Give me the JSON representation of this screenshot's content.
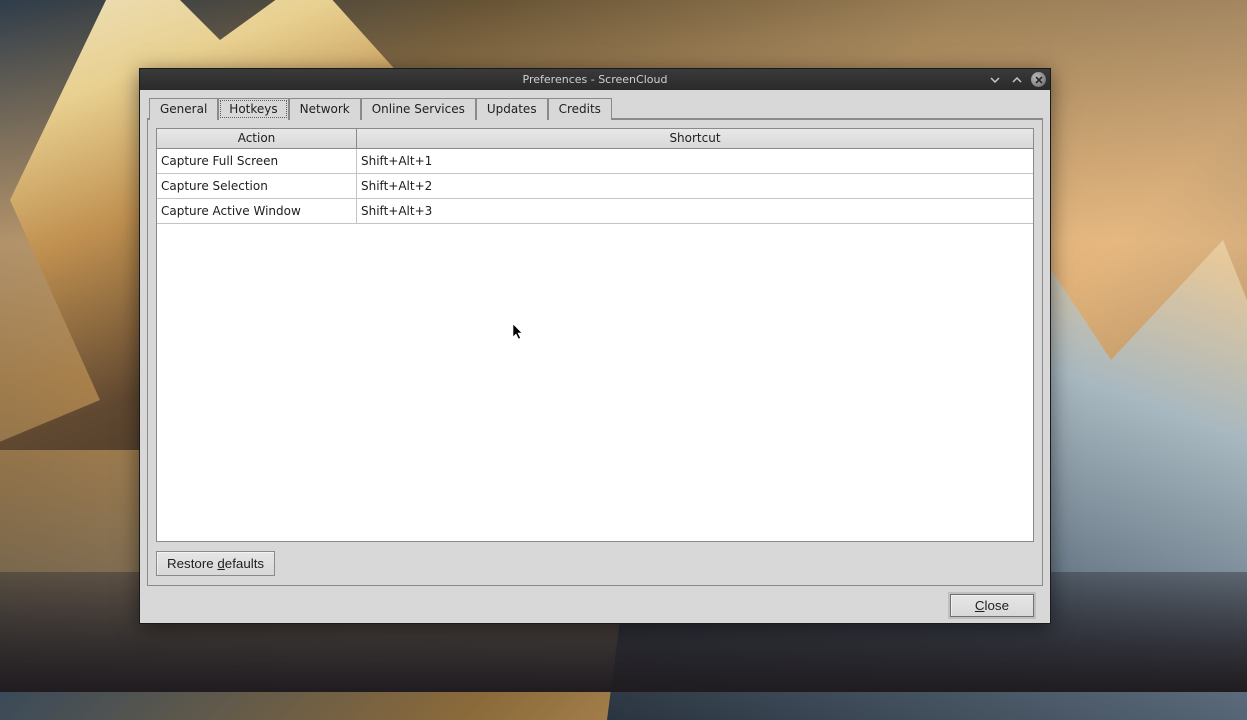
{
  "window": {
    "title": "Preferences - ScreenCloud"
  },
  "tabs": [
    {
      "id": "general",
      "label": "General"
    },
    {
      "id": "hotkeys",
      "label": "Hotkeys"
    },
    {
      "id": "network",
      "label": "Network"
    },
    {
      "id": "online-services",
      "label": "Online Services"
    },
    {
      "id": "updates",
      "label": "Updates"
    },
    {
      "id": "credits",
      "label": "Credits"
    }
  ],
  "active_tab": "hotkeys",
  "hotkeys_table": {
    "columns": {
      "action": "Action",
      "shortcut": "Shortcut"
    },
    "rows": [
      {
        "action": "Capture Full Screen",
        "shortcut": "Shift+Alt+1"
      },
      {
        "action": "Capture Selection",
        "shortcut": "Shift+Alt+2"
      },
      {
        "action": "Capture Active Window",
        "shortcut": "Shift+Alt+3"
      }
    ]
  },
  "buttons": {
    "restore_defaults_pre": "Restore ",
    "restore_defaults_ukey": "d",
    "restore_defaults_post": "efaults",
    "close_ukey": "C",
    "close_post": "lose"
  },
  "titlebar_icons": {
    "shade": "shade-icon",
    "unshade": "unshade-icon",
    "close": "close-icon"
  }
}
